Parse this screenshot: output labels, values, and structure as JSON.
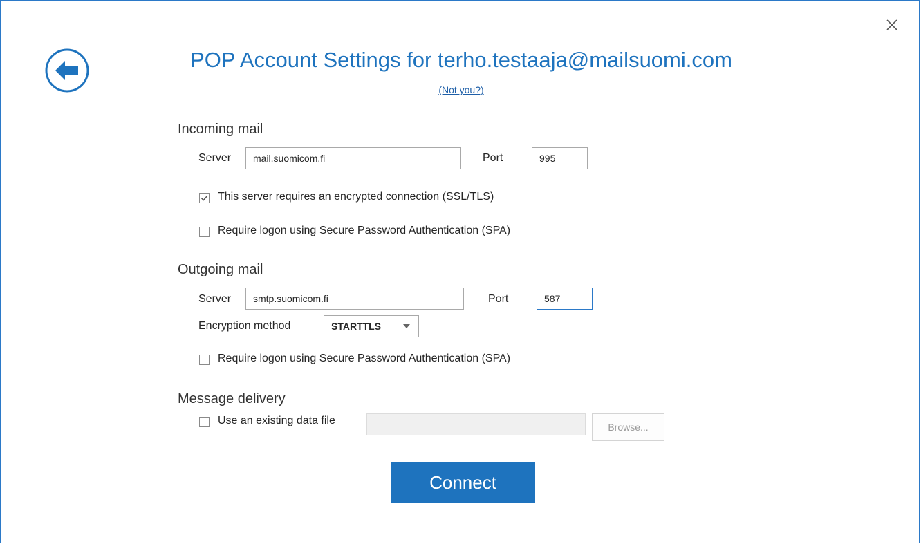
{
  "dialog": {
    "title": "POP Account Settings for terho.testaaja@mailsuomi.com",
    "not_you_link": "(Not you?)",
    "accent_color": "#1e73be"
  },
  "incoming": {
    "section_title": "Incoming mail",
    "server_label": "Server",
    "server_value": "mail.suomicom.fi",
    "port_label": "Port",
    "port_value": "995",
    "ssl_checkbox_label": "This server requires an encrypted connection (SSL/TLS)",
    "ssl_checked": true,
    "spa_checkbox_label": "Require logon using Secure Password Authentication (SPA)",
    "spa_checked": false
  },
  "outgoing": {
    "section_title": "Outgoing mail",
    "server_label": "Server",
    "server_value": "smtp.suomicom.fi",
    "port_label": "Port",
    "port_value": "587",
    "encryption_label": "Encryption method",
    "encryption_value": "STARTTLS",
    "spa_checkbox_label": "Require logon using Secure Password Authentication (SPA)",
    "spa_checked": false
  },
  "delivery": {
    "section_title": "Message delivery",
    "existing_file_label": "Use an existing data file",
    "existing_file_checked": false,
    "file_path_value": "",
    "browse_label": "Browse..."
  },
  "actions": {
    "connect_label": "Connect"
  },
  "icons": {
    "close": "close-icon",
    "back": "back-arrow-icon",
    "checkmark": "checkmark-icon",
    "dropdown": "chevron-down-icon"
  }
}
